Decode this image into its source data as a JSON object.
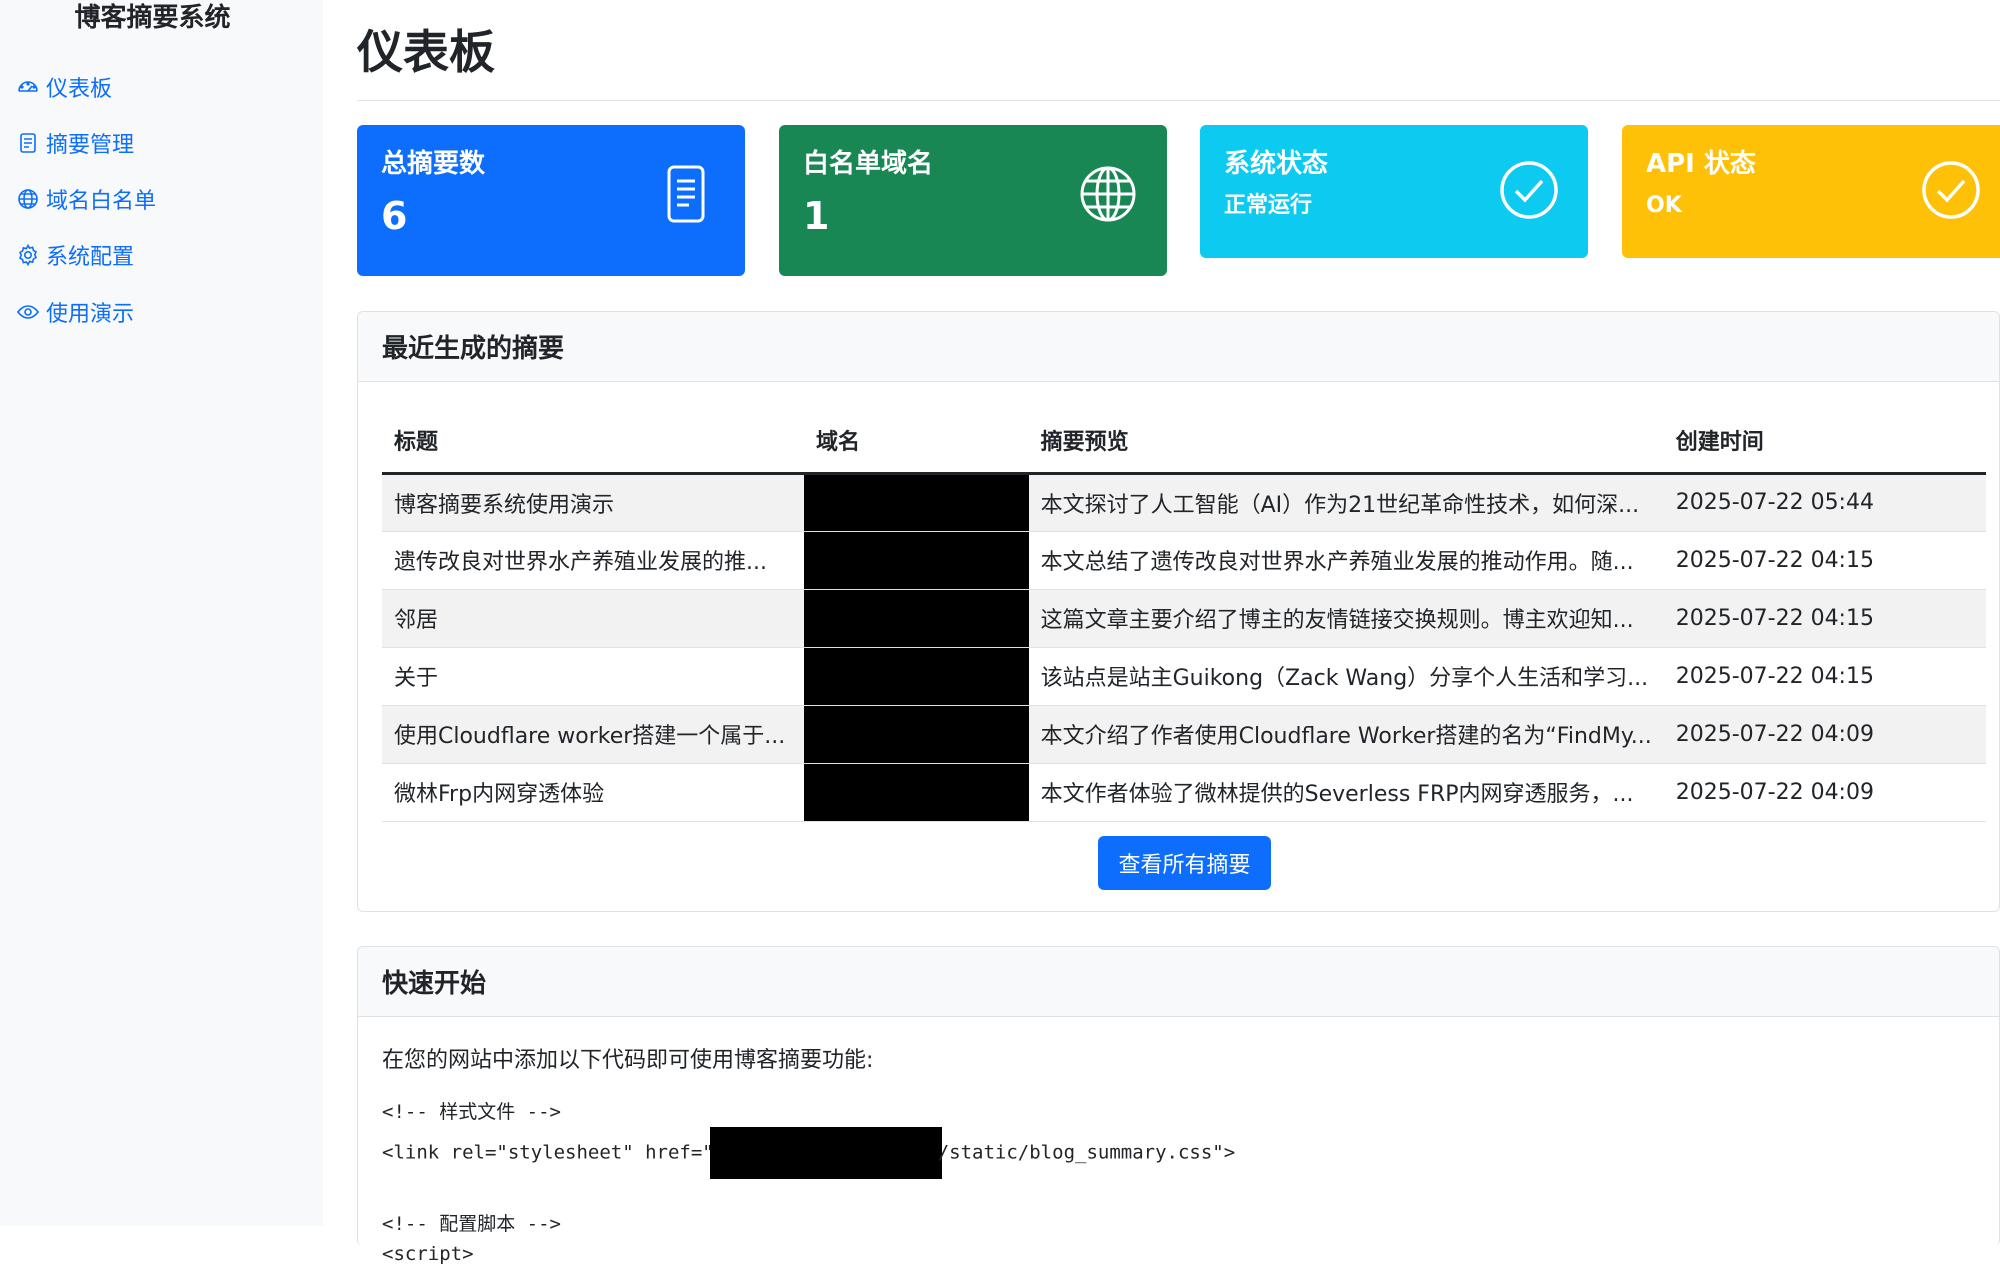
{
  "app": {
    "title": "博客摘要系统"
  },
  "sidebar": {
    "items": [
      {
        "label": "仪表板",
        "icon": "speedometer-icon"
      },
      {
        "label": "摘要管理",
        "icon": "document-icon"
      },
      {
        "label": "域名白名单",
        "icon": "globe-icon"
      },
      {
        "label": "系统配置",
        "icon": "gear-icon"
      },
      {
        "label": "使用演示",
        "icon": "eye-icon"
      }
    ]
  },
  "page": {
    "title": "仪表板"
  },
  "stats": [
    {
      "label": "总摘要数",
      "value": "6",
      "color": "#0d6efd",
      "icon": "document-icon"
    },
    {
      "label": "白名单域名",
      "value": "1",
      "color": "#198754",
      "icon": "globe-icon"
    },
    {
      "label": "系统状态",
      "value": "正常运行",
      "color": "#0dcaf0",
      "icon": "check-circle-icon"
    },
    {
      "label": "API 状态",
      "value": "OK",
      "color": "#ffc107",
      "icon": "check-circle-icon"
    }
  ],
  "recent": {
    "header": "最近生成的摘要",
    "columns": [
      "标题",
      "域名",
      "摘要预览",
      "创建时间"
    ],
    "rows": [
      {
        "title": "博客摘要系统使用演示",
        "preview": "本文探讨了人工智能（AI）作为21世纪革命性技术，如何深...",
        "time": "2025-07-22 05:44"
      },
      {
        "title": "遗传改良对世界水产养殖业发展的推...",
        "preview": "本文总结了遗传改良对世界水产养殖业发展的推动作用。随...",
        "time": "2025-07-22 04:15"
      },
      {
        "title": "邻居",
        "preview": "这篇文章主要介绍了博主的友情链接交换规则。博主欢迎知...",
        "time": "2025-07-22 04:15"
      },
      {
        "title": "关于",
        "preview": "该站点是站主Guikong（Zack Wang）分享个人生活和学习...",
        "time": "2025-07-22 04:15"
      },
      {
        "title": "使用Cloudflare worker搭建一个属于...",
        "preview": "本文介绍了作者使用Cloudflare Worker搭建的名为“FindMy...",
        "time": "2025-07-22 04:09"
      },
      {
        "title": "微林Frp内网穿透体验",
        "preview": "本文作者体验了微林提供的Severless FRP内网穿透服务，...",
        "time": "2025-07-22 04:09"
      }
    ],
    "view_all": "查看所有摘要"
  },
  "quickstart": {
    "header": "快速开始",
    "intro": "在您的网站中添加以下代码即可使用博客摘要功能:",
    "comment_style": "<!-- 样式文件 -->",
    "link_prefix": "<link rel=\"stylesheet\" href=\"",
    "link_suffix": "/static/blog_summary.css\">",
    "comment_script": "<!-- 配置脚本 -->",
    "script_tag": "<script>"
  }
}
